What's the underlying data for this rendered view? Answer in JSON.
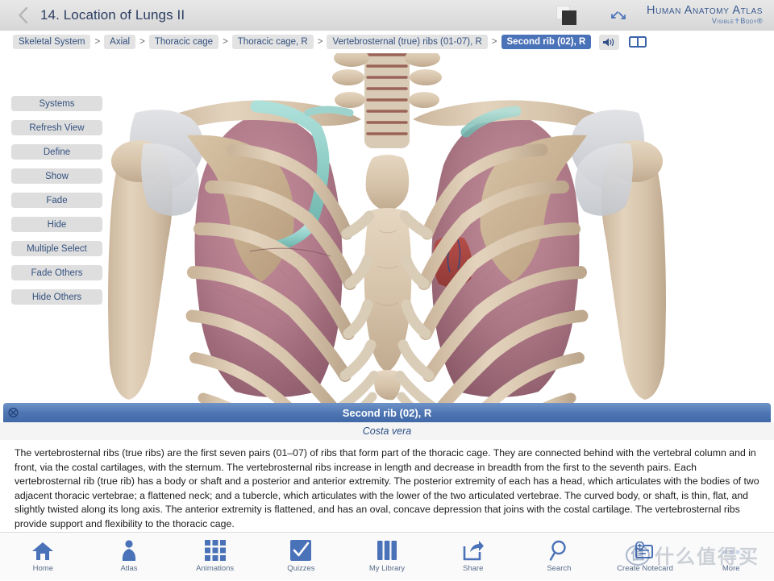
{
  "header": {
    "back_icon": "chevron-left-icon",
    "title": "14. Location of Lungs II",
    "square_toggle_icon": "background-toggle-icon",
    "expand_icon": "fullscreen-expand-icon",
    "brand_main": "Human Anatomy Atlas",
    "brand_sub_left": "Visible",
    "brand_sub_right": "Body",
    "brand_color": "#3a5a90"
  },
  "breadcrumb": {
    "items": [
      {
        "label": "Skeletal System",
        "active": false
      },
      {
        "label": "Axial",
        "active": false
      },
      {
        "label": "Thoracic cage",
        "active": false
      },
      {
        "label": "Thoracic cage, R",
        "active": false
      },
      {
        "label": "Vertebrosternal (true) ribs (01-07), R",
        "active": false
      },
      {
        "label": "Second rib (02), R",
        "active": true
      }
    ],
    "separator": ">",
    "audio_icon": "speaker-icon",
    "book_icon": "book-icon",
    "active_color": "#4a72b8"
  },
  "tools": {
    "buttons": [
      {
        "label": "Systems"
      },
      {
        "label": "Refresh View"
      },
      {
        "label": "Define"
      },
      {
        "label": "Show"
      },
      {
        "label": "Fade"
      },
      {
        "label": "Hide"
      },
      {
        "label": "Multiple Select"
      },
      {
        "label": "Fade Others"
      },
      {
        "label": "Hide Others"
      }
    ]
  },
  "viewport": {
    "model": "anterior thoracic cage with lungs",
    "highlight_structure": "Second rib (02), R",
    "highlight_color": "#8fd0cb",
    "bone_color": "#ddc9b0",
    "lung_color": "#b5808f"
  },
  "info": {
    "close_icon": "close-icon",
    "title": "Second rib (02), R",
    "subtitle": "Costa vera",
    "body": "The vertebrosternal ribs (true ribs) are the first seven pairs (01–07) of ribs that form part of the thoracic cage. They are connected behind with the vertebral column and in front, via the costal cartilages, with the sternum. The vertebrosternal ribs increase in length and decrease in breadth from the first to the seventh pairs. Each vertebrosternal rib (true rib) has a body or shaft and a posterior and anterior extremity. The posterior extremity of each has a head, which articulates with the bodies of two adjacent thoracic vertebrae; a flattened neck; and a tubercle, which articulates with the lower of the two articulated vertebrae. The curved body, or shaft, is thin, flat, and slightly twisted along its long axis. The anterior extremity is flattened, and has an oval, concave depression that joins with the costal cartilage. The vertebrosternal ribs provide support and flexibility to the thoracic cage."
  },
  "bottomnav": {
    "items": [
      {
        "label": "Home",
        "icon": "home-icon"
      },
      {
        "label": "Atlas",
        "icon": "person-icon"
      },
      {
        "label": "Animations",
        "icon": "grid-icon"
      },
      {
        "label": "Quizzes",
        "icon": "checkmark-icon"
      },
      {
        "label": "My Library",
        "icon": "books-icon"
      },
      {
        "label": "Share",
        "icon": "share-icon"
      },
      {
        "label": "Search",
        "icon": "magnifier-icon"
      },
      {
        "label": "Create Notecard",
        "icon": "notecard-plus-icon"
      },
      {
        "label": "More",
        "icon": "more-icon"
      }
    ],
    "icon_color": "#4a72b8"
  },
  "watermark": {
    "logo_glyph": "值",
    "text": "什么值得买"
  }
}
